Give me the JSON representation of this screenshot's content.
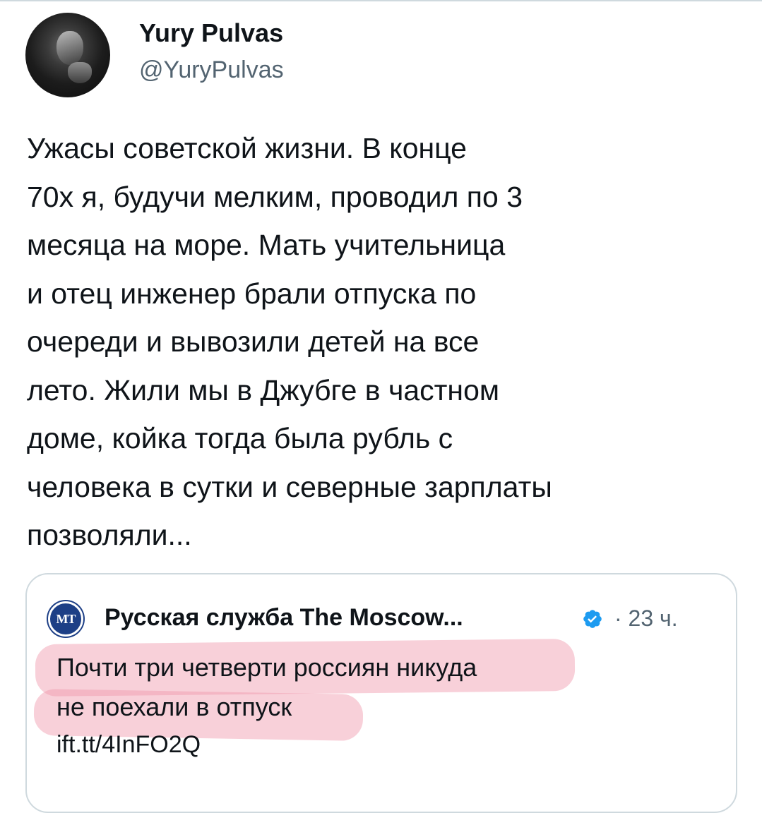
{
  "author": {
    "name": "Yury Pulvas",
    "handle": "@YuryPulvas"
  },
  "tweet": {
    "text": "Ужасы советской жизни. В  конце\n70х я, будучи мелким, проводил по 3\nмесяца на море. Мать учительница\nи отец инженер брали отпуска по\nочереди и  вывозили детей на все\nлето. Жили мы в Джубге в частном\nдоме, койка тогда была рубль с\nчеловека в сутки и северные зарплаты\nпозволяли..."
  },
  "quoted": {
    "avatar_text": "MT",
    "name": "Русская служба The Moscow...",
    "time": "· 23 ч.",
    "text": "Почти три четверти россиян никуда\nне поехали в отпуск",
    "link": "ift.tt/4InFO2Q",
    "verified_icon": "verified-badge-icon",
    "highlight_color": "#f096aa"
  }
}
